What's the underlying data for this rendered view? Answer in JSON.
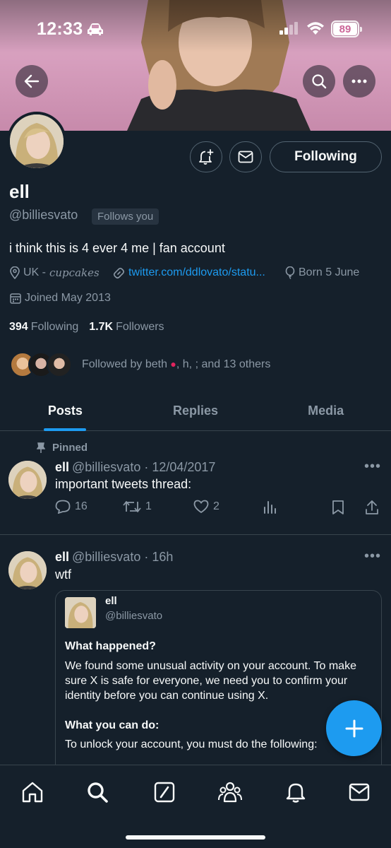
{
  "status_bar": {
    "time": "12:33",
    "battery": "89"
  },
  "profile": {
    "name": "ell",
    "handle": "@billiesvato",
    "follows_you": "Follows you",
    "bio": "i think this is 4 ever 4 me | fan account",
    "location": "UK -",
    "location_deco": "cupcakes",
    "link": "twitter.com/ddlovato/statu...",
    "born": "Born 5 June",
    "joined": "Joined May 2013",
    "following_count": "394",
    "following_label": "Following",
    "followers_count": "1.7K",
    "followers_label": "Followers",
    "followed_by_prefix": "Followed by beth",
    "followed_by_suffix": ", h, ; and 13 others",
    "following_button": "Following"
  },
  "tabs": [
    {
      "label": "Posts",
      "active": true
    },
    {
      "label": "Replies",
      "active": false
    },
    {
      "label": "Media",
      "active": false
    }
  ],
  "tweets": [
    {
      "pinned_label": "Pinned",
      "name": "ell",
      "handle": "@billiesvato",
      "time": "12/04/2017",
      "text": "important tweets thread:",
      "replies": "16",
      "retweets": "1",
      "likes": "2"
    },
    {
      "name": "ell",
      "handle": "@billiesvato",
      "time": "16h",
      "text": "wtf",
      "quote": {
        "name": "ell",
        "handle": "@billiesvato",
        "heading1": "What happened?",
        "para1": "We found some unusual activity on your account. To make sure X is safe for everyone, we need you to confirm your identity before you can continue using X.",
        "heading2": "What you can do:",
        "para2": "To unlock your account, you must do the following:"
      }
    }
  ],
  "colors": {
    "background": "#15202b",
    "accent": "#1d9bf0",
    "muted": "#8b98a5",
    "border": "#38444d"
  }
}
